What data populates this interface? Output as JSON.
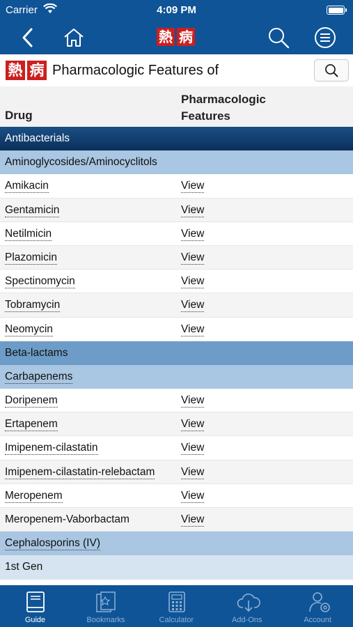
{
  "status": {
    "carrier": "Carrier",
    "time": "4:09 PM"
  },
  "logo": {
    "char1": "熱",
    "char2": "病"
  },
  "page": {
    "title": "Pharmacologic Features of"
  },
  "table": {
    "col1": "Drug",
    "col2a": "Pharmacologic",
    "col2b": "Features"
  },
  "rows": [
    {
      "type": "cat-dark",
      "name": "Antibacterials"
    },
    {
      "type": "cat-light",
      "name": "Aminoglycosides/Aminocyclitols"
    },
    {
      "type": "drug",
      "name": "Amikacin",
      "link": "View"
    },
    {
      "type": "drug",
      "name": "Gentamicin",
      "link": "View"
    },
    {
      "type": "drug",
      "name": "Netilmicin",
      "link": "View"
    },
    {
      "type": "drug",
      "name": "Plazomicin",
      "link": "View"
    },
    {
      "type": "drug",
      "name": "Spectinomycin",
      "link": "View"
    },
    {
      "type": "drug",
      "name": "Tobramycin",
      "link": "View"
    },
    {
      "type": "drug",
      "name": "Neomycin",
      "link": "View"
    },
    {
      "type": "cat-mid",
      "name": "Beta-lactams"
    },
    {
      "type": "cat-light",
      "name": "Carbapenems",
      "underline": true
    },
    {
      "type": "drug",
      "name": "Doripenem",
      "link": "View"
    },
    {
      "type": "drug",
      "name": "Ertapenem",
      "link": "View"
    },
    {
      "type": "drug",
      "name": "Imipenem-cilastatin",
      "link": "View"
    },
    {
      "type": "drug",
      "name": "Imipenem-cilastatin-relebactam",
      "link": "View"
    },
    {
      "type": "drug",
      "name": "Meropenem",
      "link": "View"
    },
    {
      "type": "drug",
      "name": "Meropenem-Vaborbactam",
      "link": "View",
      "plain": true
    },
    {
      "type": "cat-light",
      "name": "Cephalosporins (IV)",
      "underline": true
    },
    {
      "type": "cat-lighter",
      "name": "1st Gen"
    }
  ],
  "tabs": [
    {
      "label": "Guide",
      "icon": "book-icon",
      "active": true
    },
    {
      "label": "Bookmarks",
      "icon": "bookmarks-icon"
    },
    {
      "label": "Calculator",
      "icon": "calculator-icon"
    },
    {
      "label": "Add-Ons",
      "icon": "cloud-download-icon"
    },
    {
      "label": "Account",
      "icon": "account-gear-icon"
    }
  ]
}
